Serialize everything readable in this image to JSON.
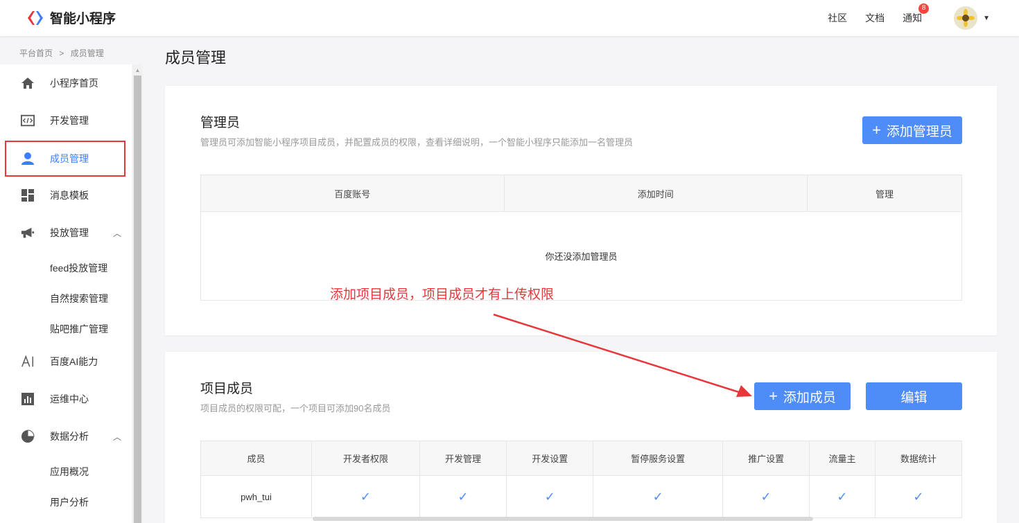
{
  "header": {
    "logo_text": "智能小程序",
    "links": [
      "社区",
      "文档",
      "通知"
    ],
    "notification_count": "8"
  },
  "breadcrumb": [
    "平台首页",
    ">",
    "成员管理"
  ],
  "sidebar": {
    "items": [
      {
        "label": "小程序首页",
        "icon": "home-icon"
      },
      {
        "label": "开发管理",
        "icon": "code-icon"
      },
      {
        "label": "成员管理",
        "icon": "user-icon",
        "active": true
      },
      {
        "label": "消息模板",
        "icon": "template-grid-icon"
      },
      {
        "label": "投放管理",
        "icon": "megaphone-icon",
        "expanded": true
      },
      {
        "label": "百度AI能力",
        "icon": "ai-icon"
      },
      {
        "label": "运维中心",
        "icon": "bar-chart-icon"
      },
      {
        "label": "数据分析",
        "icon": "pie-chart-icon",
        "expanded": true
      }
    ],
    "sub_items": {
      "delivery": [
        "feed投放管理",
        "自然搜索管理",
        "贴吧推广管理"
      ],
      "analytics": [
        "应用概况",
        "用户分析"
      ]
    }
  },
  "page_title": "成员管理",
  "admin_section": {
    "title": "管理员",
    "description": "管理员可添加智能小程序项目成员，并配置成员的权限，查看详细说明，一个智能小程序只能添加一名管理员",
    "add_button": "添加管理员",
    "columns": [
      "百度账号",
      "添加时间",
      "管理"
    ],
    "empty_text": "你还没添加管理员"
  },
  "annotation_text": "添加项目成员，项目成员才有上传权限",
  "member_section": {
    "title": "项目成员",
    "description": "项目成员的权限可配，一个项目可添加90名成员",
    "add_button": "添加成员",
    "edit_button": "编辑",
    "columns": [
      "成员",
      "开发者权限",
      "开发管理",
      "开发设置",
      "暂停服务设置",
      "推广设置",
      "流量主",
      "数据统计"
    ],
    "rows": [
      {
        "name": "pwh_tui",
        "checks": [
          true,
          true,
          true,
          true,
          true,
          true,
          true
        ]
      }
    ]
  },
  "colors": {
    "primary": "#4e8cf7",
    "annotation": "#e8373b",
    "active_nav": "#3c7eff"
  }
}
